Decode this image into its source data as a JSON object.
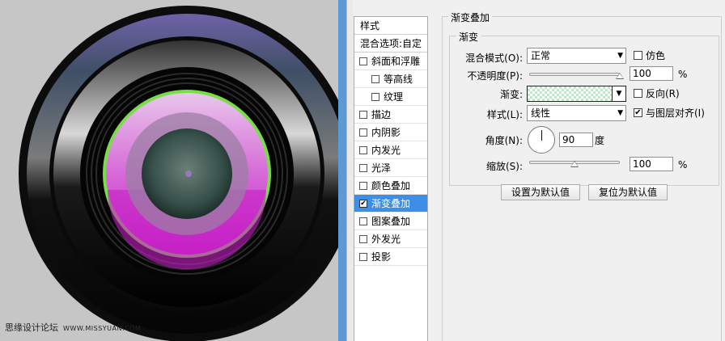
{
  "watermark": {
    "site": "思缘设计论坛",
    "url": "WWW.MISSYUAN.COM"
  },
  "style_list": {
    "header": "样式",
    "blend_options": "混合选项:自定",
    "items": [
      {
        "label": "斜面和浮雕",
        "checked": false,
        "indent": false
      },
      {
        "label": "等高线",
        "checked": false,
        "indent": true
      },
      {
        "label": "纹理",
        "checked": false,
        "indent": true
      },
      {
        "label": "描边",
        "checked": false,
        "indent": false
      },
      {
        "label": "内阴影",
        "checked": false,
        "indent": false
      },
      {
        "label": "内发光",
        "checked": false,
        "indent": false
      },
      {
        "label": "光泽",
        "checked": false,
        "indent": false
      },
      {
        "label": "颜色叠加",
        "checked": false,
        "indent": false
      },
      {
        "label": "渐变叠加",
        "checked": true,
        "indent": false,
        "selected": true
      },
      {
        "label": "图案叠加",
        "checked": false,
        "indent": false
      },
      {
        "label": "外发光",
        "checked": false,
        "indent": false
      },
      {
        "label": "投影",
        "checked": false,
        "indent": false
      }
    ],
    "checkmark": "✔"
  },
  "panel": {
    "section_title": "渐变叠加",
    "group_title": "渐变",
    "blend_mode_label": "混合模式(O):",
    "blend_mode_value": "正常",
    "dither_label": "仿色",
    "opacity_label": "不透明度(P):",
    "opacity_value": "100",
    "opacity_unit": "%",
    "opacity_level": 1.0,
    "gradient_label": "渐变:",
    "reverse_label": "反向(R)",
    "style_label": "样式(L):",
    "style_value": "线性",
    "align_label": "与图层对齐(I)",
    "align_checked": true,
    "angle_label": "角度(N):",
    "angle_value": "90",
    "angle_unit": "度",
    "scale_label": "缩放(S):",
    "scale_value": "100",
    "scale_unit": "%",
    "scale_level": 0.5,
    "set_default_button": "设置为默认值",
    "reset_default_button": "复位为默认值"
  },
  "colors": {
    "accent": "#3c8ee6",
    "separator": "#5b9bd5"
  }
}
